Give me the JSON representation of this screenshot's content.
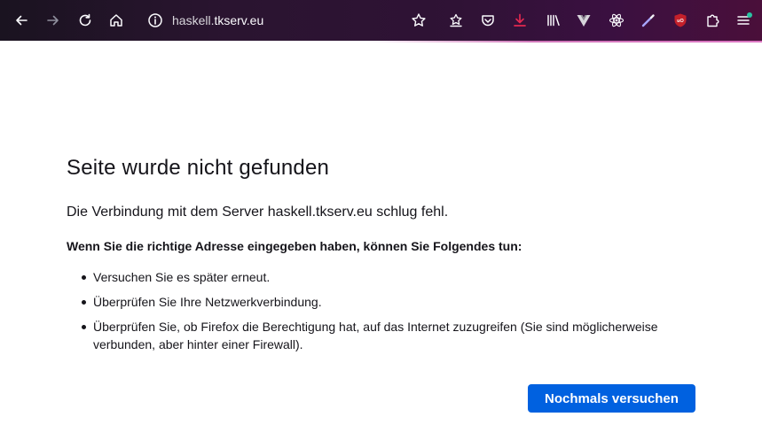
{
  "toolbar": {
    "url_prefix": "haskell.",
    "url_host": "tkserv.eu",
    "icons": [
      "back-icon",
      "forward-icon",
      "reload-icon",
      "home-icon",
      "site-info-icon",
      "bookmark-star-icon",
      "reading-list-icon",
      "pocket-icon",
      "download-icon",
      "library-icon",
      "vue-devtools-icon",
      "react-devtools-icon",
      "color-picker-icon",
      "ublock-icon",
      "extensions-icon",
      "menu-icon"
    ],
    "colors": {
      "download_accent": "#e22850",
      "ublock_red": "#c4202a",
      "notification_dot": "#2ac3a2"
    }
  },
  "error": {
    "title": "Seite wurde nicht gefunden",
    "message": "Die Verbindung mit dem Server haskell.tkserv.eu schlug fehl.",
    "subheading": "Wenn Sie die richtige Adresse eingegeben haben, können Sie Folgendes tun:",
    "suggestions": [
      "Versuchen Sie es später erneut.",
      "Überprüfen Sie Ihre Netzwerkverbindung.",
      "Überprüfen Sie, ob Firefox die Berechtigung hat, auf das Internet zuzugreifen (Sie sind möglicherweise verbunden, aber hinter einer Firewall)."
    ],
    "retry_label": "Nochmals versuchen",
    "accent_color": "#0061e0"
  }
}
